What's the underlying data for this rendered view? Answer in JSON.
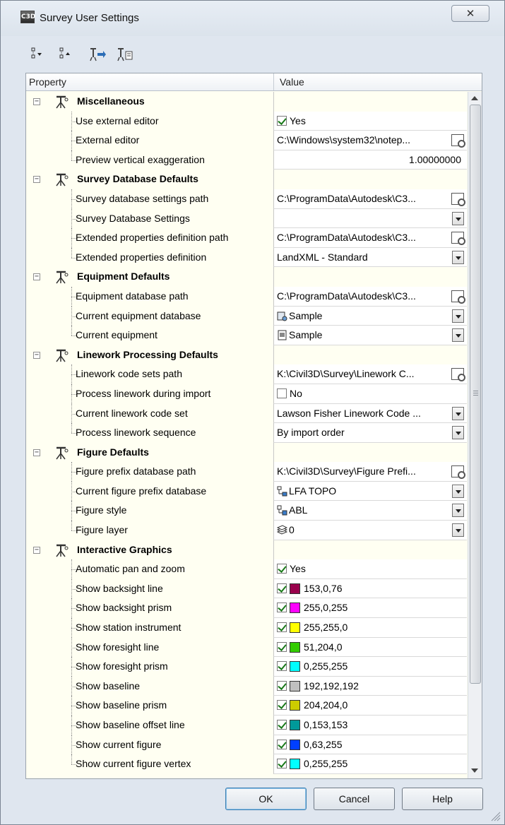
{
  "window": {
    "title": "Survey User Settings",
    "close_glyph": "✕",
    "app_icon_text": "C3D"
  },
  "toolbar": {
    "buttons": [
      {
        "name": "expand-all-icon"
      },
      {
        "name": "collapse-all-icon"
      },
      {
        "name": "import-settings-icon"
      },
      {
        "name": "export-settings-icon"
      }
    ]
  },
  "grid": {
    "header_property": "Property",
    "header_value": "Value",
    "rows": [
      {
        "type": "category",
        "label": "Miscellaneous"
      },
      {
        "type": "check",
        "label": "Use external editor",
        "checked": true,
        "value": "Yes"
      },
      {
        "type": "browse",
        "label": "External editor",
        "value": "C:\\Windows\\system32\\notep..."
      },
      {
        "type": "text-right",
        "label": "Preview vertical exaggeration",
        "value": "1.00000000"
      },
      {
        "type": "category",
        "label": "Survey Database Defaults"
      },
      {
        "type": "browse",
        "label": "Survey database settings path",
        "value": "C:\\ProgramData\\Autodesk\\C3..."
      },
      {
        "type": "dropdown",
        "label": "Survey Database Settings",
        "value": ""
      },
      {
        "type": "browse",
        "label": "Extended properties definition path",
        "value": "C:\\ProgramData\\Autodesk\\C3..."
      },
      {
        "type": "dropdown",
        "label": "Extended properties definition",
        "value": "LandXML - Standard"
      },
      {
        "type": "category",
        "label": "Equipment Defaults"
      },
      {
        "type": "browse",
        "label": "Equipment database path",
        "value": "C:\\ProgramData\\Autodesk\\C3..."
      },
      {
        "type": "dropdown",
        "label": "Current equipment database",
        "value": "Sample",
        "icon": "database-icon"
      },
      {
        "type": "dropdown",
        "label": "Current equipment",
        "value": "Sample",
        "icon": "equipment-icon"
      },
      {
        "type": "category",
        "label": "Linework Processing Defaults"
      },
      {
        "type": "browse",
        "label": "Linework code sets path",
        "value": "K:\\Civil3D\\Survey\\Linework C..."
      },
      {
        "type": "check",
        "label": "Process linework during import",
        "checked": false,
        "value": "No"
      },
      {
        "type": "dropdown",
        "label": "Current linework code set",
        "value": "Lawson Fisher Linework Code ..."
      },
      {
        "type": "dropdown",
        "label": "Process linework sequence",
        "value": "By import order"
      },
      {
        "type": "category",
        "label": "Figure Defaults"
      },
      {
        "type": "browse",
        "label": "Figure prefix database path",
        "value": "K:\\Civil3D\\Survey\\Figure Prefi..."
      },
      {
        "type": "dropdown",
        "label": "Current figure prefix database",
        "value": "LFA TOPO",
        "icon": "prefix-database-icon"
      },
      {
        "type": "dropdown",
        "label": "Figure style",
        "value": "ABL",
        "icon": "figure-style-icon"
      },
      {
        "type": "dropdown",
        "label": "Figure layer",
        "value": "0",
        "icon": "layer-icon"
      },
      {
        "type": "category",
        "label": "Interactive Graphics"
      },
      {
        "type": "check",
        "label": "Automatic pan and zoom",
        "checked": true,
        "value": "Yes"
      },
      {
        "type": "color",
        "label": "Show backsight line",
        "checked": true,
        "value": "153,0,76",
        "color": "#99004c"
      },
      {
        "type": "color",
        "label": "Show backsight prism",
        "checked": true,
        "value": "255,0,255",
        "color": "#ff00ff"
      },
      {
        "type": "color",
        "label": "Show station instrument",
        "checked": true,
        "value": "255,255,0",
        "color": "#ffff00"
      },
      {
        "type": "color",
        "label": "Show foresight line",
        "checked": true,
        "value": "51,204,0",
        "color": "#33cc00"
      },
      {
        "type": "color",
        "label": "Show foresight prism",
        "checked": true,
        "value": "0,255,255",
        "color": "#00ffff"
      },
      {
        "type": "color",
        "label": "Show baseline",
        "checked": true,
        "value": "192,192,192",
        "color": "#c0c0c0"
      },
      {
        "type": "color",
        "label": "Show baseline prism",
        "checked": true,
        "value": "204,204,0",
        "color": "#cccc00"
      },
      {
        "type": "color",
        "label": "Show baseline offset line",
        "checked": true,
        "value": "0,153,153",
        "color": "#009999"
      },
      {
        "type": "color",
        "label": "Show current figure",
        "checked": true,
        "value": "0,63,255",
        "color": "#003fff"
      },
      {
        "type": "color",
        "label": "Show current figure vertex",
        "checked": true,
        "value": "0,255,255",
        "color": "#00ffff"
      }
    ]
  },
  "buttons": {
    "ok": "OK",
    "cancel": "Cancel",
    "help": "Help"
  }
}
